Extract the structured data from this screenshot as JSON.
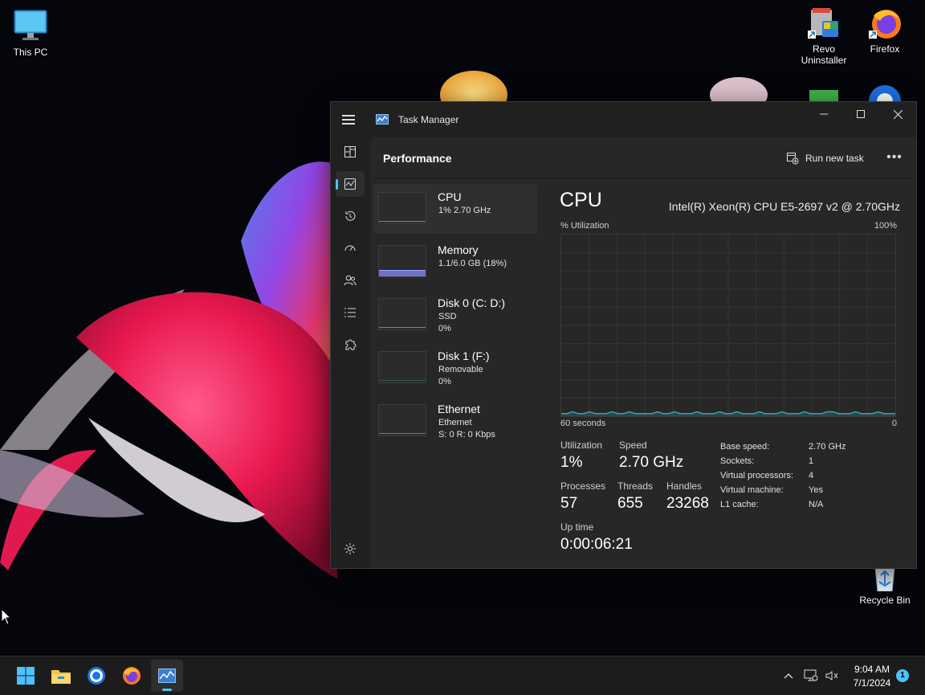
{
  "desktop": {
    "icons": [
      {
        "label": "This PC"
      },
      {
        "label": "Revo Uninstaller"
      },
      {
        "label": "Firefox"
      },
      {
        "label": "Recycle Bin"
      }
    ]
  },
  "window": {
    "title": "Task Manager",
    "controls": {
      "minimize": "—",
      "maximize": "☐",
      "close": "✕"
    }
  },
  "nav": {
    "items": [
      {
        "name": "processes",
        "active": false
      },
      {
        "name": "performance",
        "active": true
      },
      {
        "name": "app-history",
        "active": false
      },
      {
        "name": "startup-apps",
        "active": false
      },
      {
        "name": "users",
        "active": false
      },
      {
        "name": "details",
        "active": false
      },
      {
        "name": "services",
        "active": false
      }
    ],
    "settings": "settings"
  },
  "header": {
    "page_title": "Performance",
    "run_new_task": "Run new task",
    "more": "•••"
  },
  "devices": [
    {
      "name": "CPU",
      "sub1": "1%  2.70 GHz",
      "sub2": "",
      "line_color": "#3aa1b8",
      "selected": true
    },
    {
      "name": "Memory",
      "sub1": "1.1/6.0 GB (18%)",
      "sub2": "",
      "line_color": "#7a7fd6",
      "selected": false
    },
    {
      "name": "Disk 0 (C: D:)",
      "sub1": "SSD",
      "sub2": "0%",
      "line_color": "#3fa86e",
      "selected": false
    },
    {
      "name": "Disk 1 (F:)",
      "sub1": "Removable",
      "sub2": "0%",
      "line_color": "#3fa86e",
      "selected": false
    },
    {
      "name": "Ethernet",
      "sub1": "Ethernet",
      "sub2": "S: 0 R: 0 Kbps",
      "line_color": "#c4527a",
      "selected": false
    }
  ],
  "cpu": {
    "heading": "CPU",
    "model": "Intel(R) Xeon(R) CPU E5-2697 v2 @ 2.70GHz",
    "graph_label": "% Utilization",
    "graph_max": "100%",
    "graph_time": "60 seconds",
    "graph_min": "0",
    "usage_history": [
      1,
      1,
      2,
      1,
      1,
      2,
      1,
      1,
      1,
      2,
      1,
      1,
      2,
      1,
      1,
      1,
      1,
      2,
      1,
      1,
      2,
      1,
      1,
      1,
      2,
      1,
      1,
      1,
      2,
      1,
      1,
      2,
      1,
      1,
      1,
      2,
      1,
      1,
      1,
      2,
      1,
      1,
      1,
      2,
      1,
      1,
      1,
      2,
      2,
      1,
      1,
      1,
      2,
      1,
      1,
      1,
      2,
      1,
      1,
      1
    ],
    "stats": {
      "utilization_label": "Utilization",
      "utilization": "1%",
      "speed_label": "Speed",
      "speed": "2.70 GHz",
      "processes_label": "Processes",
      "processes": "57",
      "threads_label": "Threads",
      "threads": "655",
      "handles_label": "Handles",
      "handles": "23268",
      "uptime_label": "Up time",
      "uptime": "0:00:06:21"
    },
    "specs": [
      {
        "key": "Base speed:",
        "value": "2.70 GHz"
      },
      {
        "key": "Sockets:",
        "value": "1"
      },
      {
        "key": "Virtual processors:",
        "value": "4"
      },
      {
        "key": "Virtual machine:",
        "value": "Yes"
      },
      {
        "key": "L1 cache:",
        "value": "N/A"
      }
    ]
  },
  "taskbar": {
    "apps": [
      "start",
      "file-explorer",
      "chrome",
      "firefox",
      "task-manager"
    ],
    "tray_chevron": "^",
    "time": "9:04 AM",
    "date": "7/1/2024",
    "notification_count": "1"
  },
  "colors": {
    "accent": "#4cc2ff",
    "cpu_line": "#3aa1b8",
    "window_bg": "#202020",
    "content_bg": "#272727"
  }
}
